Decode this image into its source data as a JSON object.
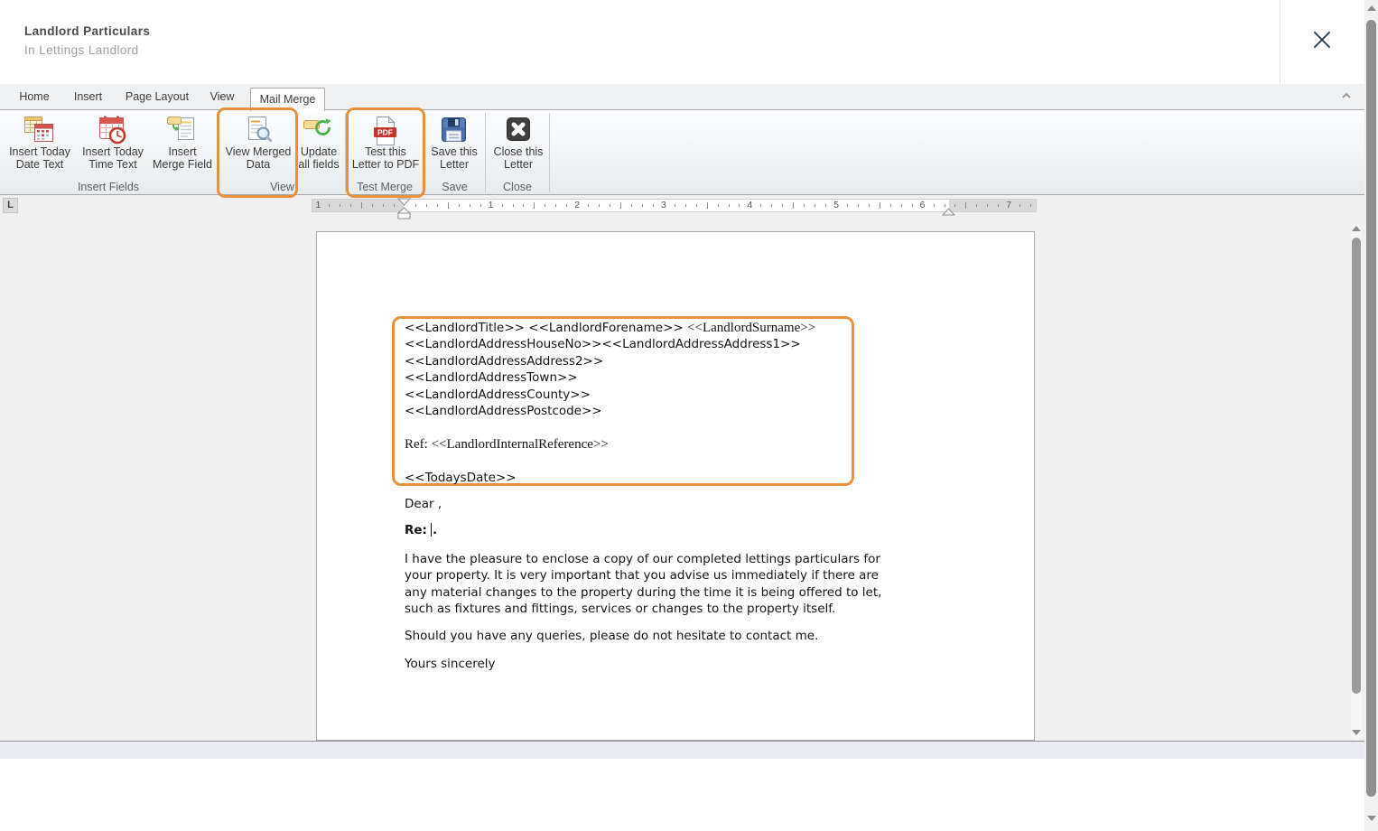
{
  "header": {
    "title": "Landlord Particulars",
    "subtitle": "In Lettings Landlord",
    "close_icon": "close-x"
  },
  "tabs": {
    "items": [
      {
        "label": "Home"
      },
      {
        "label": "Insert"
      },
      {
        "label": "Page Layout"
      },
      {
        "label": "View"
      },
      {
        "label": "Mail Merge"
      }
    ],
    "active_tab": "Mail Merge"
  },
  "ribbon": {
    "highlight_color": "#E8913C",
    "buttons": [
      {
        "id": "insert-today-date",
        "line1": "Insert Today",
        "line2": "Date Text",
        "icon": "calendar-date-icon",
        "highlighted": false
      },
      {
        "id": "insert-today-time",
        "line1": "Insert Today",
        "line2": "Time Text",
        "icon": "calendar-clock-icon",
        "highlighted": false
      },
      {
        "id": "insert-merge-field",
        "line1": "Insert",
        "line2": "Merge Field",
        "icon": "merge-field-icon",
        "highlighted": false
      },
      {
        "id": "view-merged-data",
        "line1": "View Merged",
        "line2": "Data",
        "icon": "document-magnifier-icon",
        "highlighted": true
      },
      {
        "id": "update-all-fields",
        "line1": "Update",
        "line2": "all fields",
        "icon": "refresh-field-icon",
        "highlighted": false
      },
      {
        "id": "test-letter-to-pdf",
        "line1": "Test this",
        "line2": "Letter to PDF",
        "icon": "pdf-icon",
        "highlighted": true
      },
      {
        "id": "save-letter",
        "line1": "Save this",
        "line2": "Letter",
        "icon": "floppy-disk-icon",
        "highlighted": false
      },
      {
        "id": "close-letter",
        "line1": "Close this",
        "line2": "Letter",
        "icon": "close-square-icon",
        "highlighted": false
      }
    ],
    "groups": [
      {
        "label": "Insert Fields"
      },
      {
        "label": "View"
      },
      {
        "label": "Test Merge"
      },
      {
        "label": "Save"
      },
      {
        "label": "Close"
      }
    ]
  },
  "ruler": {
    "tab_stop": "L",
    "left_labels": [
      "1"
    ],
    "right_labels": [
      "1",
      "2",
      "3",
      "4",
      "5",
      "6",
      "7"
    ]
  },
  "document": {
    "merge_block": {
      "line1_sans": "<<LandlordTitle>> <<LandlordForename>> ",
      "line1_serif": "<<LandlordSurname>>",
      "line2": "<<LandlordAddressHouseNo>><<LandlordAddressAddress1>>",
      "line3": "<<LandlordAddressAddress2>>",
      "line4": "<<LandlordAddressTown>>",
      "line5": "<<LandlordAddressCounty>>",
      "line6": "<<LandlordAddressPostcode>>",
      "ref_line": "Ref: <<LandlordInternalReference>>",
      "date_line": "<<TodaysDate>>"
    },
    "salutation": "Dear ,",
    "re_prefix": "Re:",
    "re_suffix": ".",
    "para1_lines": [
      "I have the pleasure to enclose a copy of our completed lettings particulars for",
      "your property. It is very important that you advise us immediately if there are",
      "any material changes to the property during the time it is being offered to let,",
      "such as fixtures and fittings, services or changes to the property itself."
    ],
    "para2": "Should you have any queries, please do not hesitate to contact me.",
    "closing": "Yours sincerely"
  }
}
